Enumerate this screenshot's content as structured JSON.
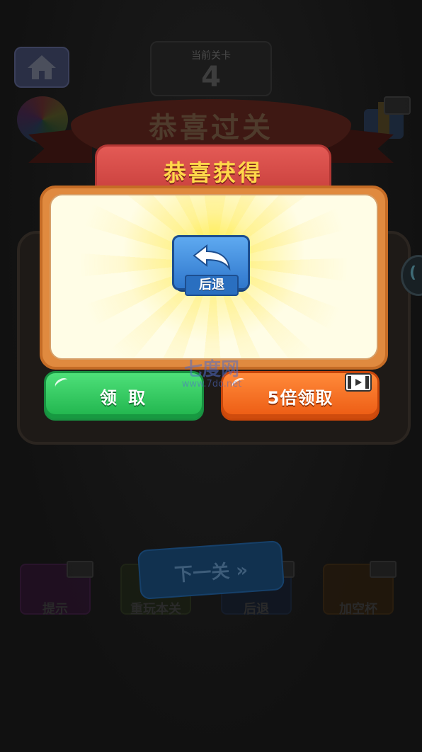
{
  "header": {
    "level_label": "当前关卡",
    "level_number": "4",
    "home_icon": "home-icon"
  },
  "banner": {
    "title": "恭喜过关"
  },
  "popup": {
    "title": "恭喜获得",
    "reward": {
      "icon": "undo-arrow-icon",
      "label": "后退"
    },
    "buttons": {
      "claim_label": "领 取",
      "claim5x_label": "5倍领取"
    }
  },
  "tools": [
    {
      "label": "提示"
    },
    {
      "label": "重玩本关"
    },
    {
      "label": "后退"
    },
    {
      "label": "加空杯"
    }
  ],
  "next_button": {
    "label": "下一关 »"
  },
  "watermark": {
    "line1": "七度网",
    "line2": "www.7do.net"
  },
  "colors": {
    "claim_green": "#1fb34c",
    "claim5x_orange": "#ec5a12",
    "header_red": "#d24a46",
    "title_yellow": "#ffd84a",
    "reward_blue": "#2f77cc"
  }
}
